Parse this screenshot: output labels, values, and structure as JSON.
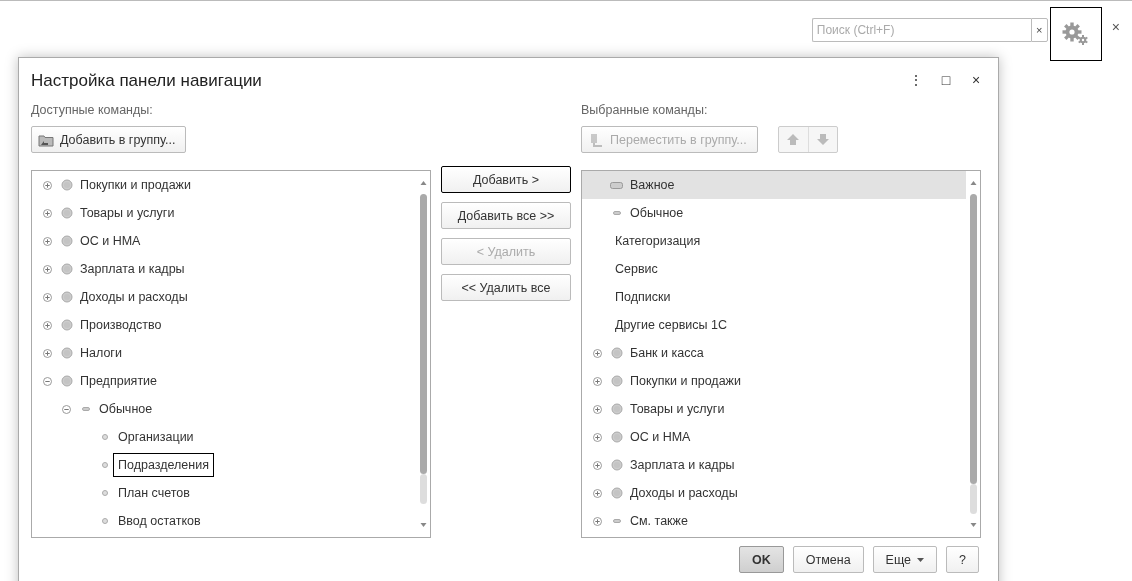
{
  "top_bar": {
    "search": {
      "placeholder": "Поиск (Ctrl+F)",
      "clear": "×"
    },
    "settings_outlined": true,
    "close": "×"
  },
  "dialog": {
    "title": "Настройка панели навигации",
    "header_buttons": [
      "⋮",
      "□",
      "×"
    ],
    "available": {
      "label": "Доступные команды:",
      "button": "Добавить в группу...",
      "tree": [
        {
          "label": "Покупки и продажи",
          "kind": "group",
          "expanded": false,
          "selected": false
        },
        {
          "label": "Товары и услуги",
          "kind": "group",
          "expanded": false,
          "selected": false
        },
        {
          "label": "ОС и НМА",
          "kind": "group",
          "expanded": false,
          "selected": false
        },
        {
          "label": "Зарплата и кадры",
          "kind": "group",
          "expanded": false,
          "selected": false
        },
        {
          "label": "Доходы и расходы",
          "kind": "group",
          "expanded": false,
          "selected": false
        },
        {
          "label": "Производство",
          "kind": "group",
          "expanded": false,
          "selected": false
        },
        {
          "label": "Налоги",
          "kind": "group",
          "expanded": false,
          "selected": false
        },
        {
          "label": "Предприятие",
          "kind": "group",
          "expanded": true,
          "selected": false,
          "children": [
            {
              "label": "Обычное",
              "kind": "normal",
              "expanded": true,
              "selected": false,
              "children": [
                {
                  "label": "Организации",
                  "kind": "command",
                  "selected": false
                },
                {
                  "label": "Подразделения",
                  "kind": "command",
                  "selected": true
                },
                {
                  "label": "План счетов",
                  "kind": "command",
                  "selected": false
                },
                {
                  "label": "Ввод остатков",
                  "kind": "command",
                  "selected": false
                }
              ]
            }
          ]
        }
      ]
    },
    "middle_buttons": [
      {
        "label": "Добавить >",
        "disabled": false,
        "focused": true
      },
      {
        "label": "Добавить все >>",
        "disabled": false,
        "focused": false
      },
      {
        "label": "< Удалить",
        "disabled": true,
        "focused": false
      },
      {
        "label": "<< Удалить все",
        "disabled": false,
        "focused": false
      }
    ],
    "selected": {
      "label": "Выбранные команды:",
      "button": "Переместить в группу...",
      "button_disabled": true,
      "tree": [
        {
          "label": "Важное",
          "kind": "important",
          "selected": true
        },
        {
          "label": "Обычное",
          "kind": "normal",
          "selected": false
        },
        {
          "label": "Категоризация",
          "kind": "plain",
          "selected": false
        },
        {
          "label": "Сервис",
          "kind": "plain",
          "selected": false
        },
        {
          "label": "Подписки",
          "kind": "plain",
          "selected": false
        },
        {
          "label": "Другие сервисы 1С",
          "kind": "plain",
          "selected": false
        },
        {
          "label": "Банк и касса",
          "kind": "group",
          "expanded": false,
          "selected": false
        },
        {
          "label": "Покупки и продажи",
          "kind": "group",
          "expanded": false,
          "selected": false
        },
        {
          "label": "Товары и услуги",
          "kind": "group",
          "expanded": false,
          "selected": false
        },
        {
          "label": "ОС и НМА",
          "kind": "group",
          "expanded": false,
          "selected": false
        },
        {
          "label": "Зарплата и кадры",
          "kind": "group",
          "expanded": false,
          "selected": false
        },
        {
          "label": "Доходы и расходы",
          "kind": "group",
          "expanded": false,
          "selected": false
        },
        {
          "label": "См. также",
          "kind": "normal",
          "expanded": false,
          "selected": false
        }
      ]
    },
    "footer_buttons": [
      {
        "label": "OK",
        "kind": "default"
      },
      {
        "label": "Отмена",
        "kind": "plain"
      },
      {
        "label": "Еще",
        "kind": "menu"
      },
      {
        "label": "?",
        "kind": "plain"
      }
    ]
  }
}
